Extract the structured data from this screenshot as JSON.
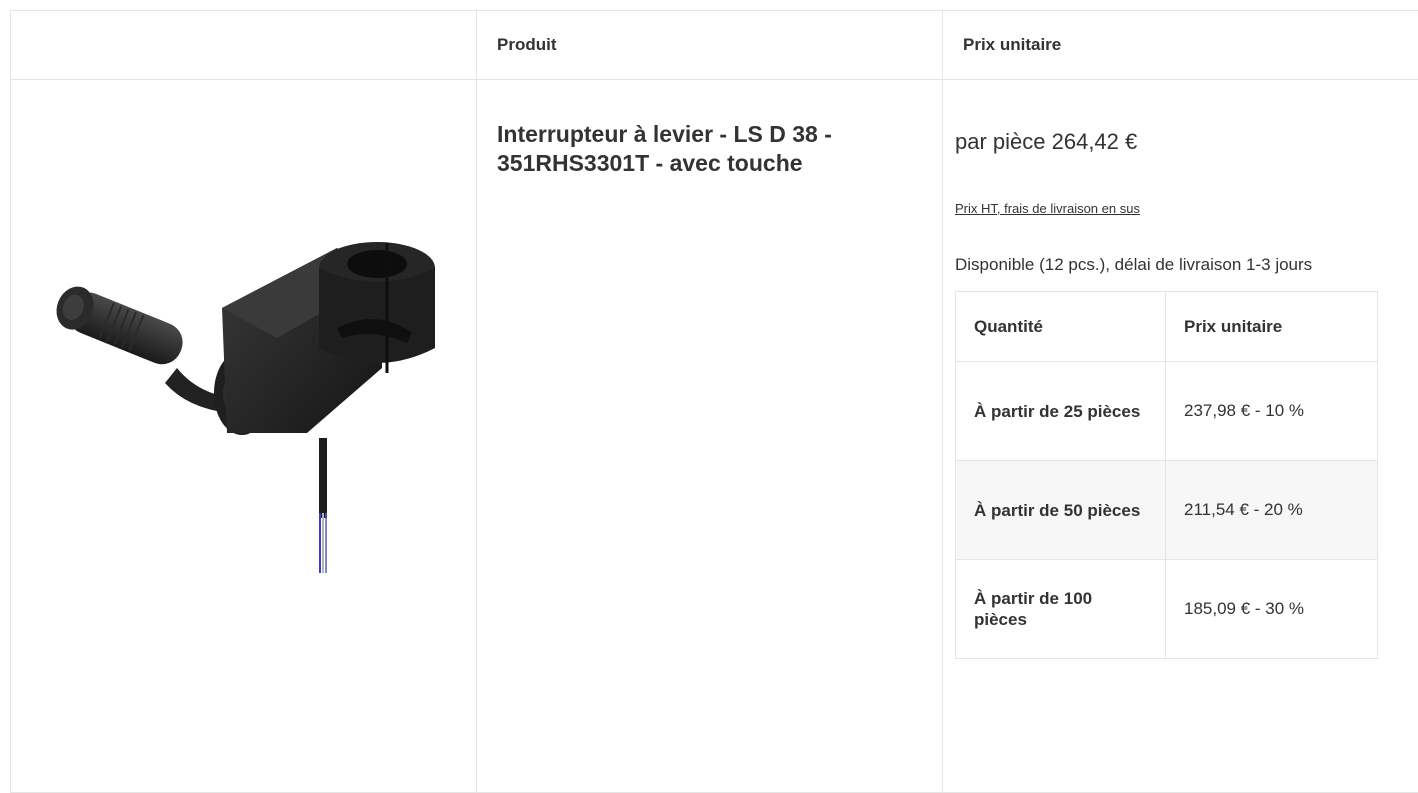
{
  "table": {
    "headers": [
      "",
      "Produit",
      "Prix unitaire"
    ]
  },
  "product": {
    "image_alt": "Interrupteur à levier - LS D 38 - 351RHS3301T - avec touche",
    "name": "Interrupteur à levier - LS D 38 - 351RHS3301T - avec touche",
    "price_line": "par pièce 264,42 €",
    "price_note": "Prix HT, frais de livraison en sus",
    "availability": "Disponible (12 pcs.), délai de livraison 1-3 jours"
  },
  "tiers": {
    "headers": [
      "Quantité",
      "Prix unitaire"
    ],
    "rows": [
      {
        "quantity": "À partir de 25 pièces",
        "price": "237,98 € - 10 %"
      },
      {
        "quantity": "À partir de 50 pièces",
        "price": "211,54 € - 20 %"
      },
      {
        "quantity": "À partir de 100 pièces",
        "price": "185,09 € - 30 %"
      }
    ]
  },
  "colors": {
    "border": "#e5e5e5",
    "text": "#333333",
    "alt_row": "#f7f7f7"
  }
}
